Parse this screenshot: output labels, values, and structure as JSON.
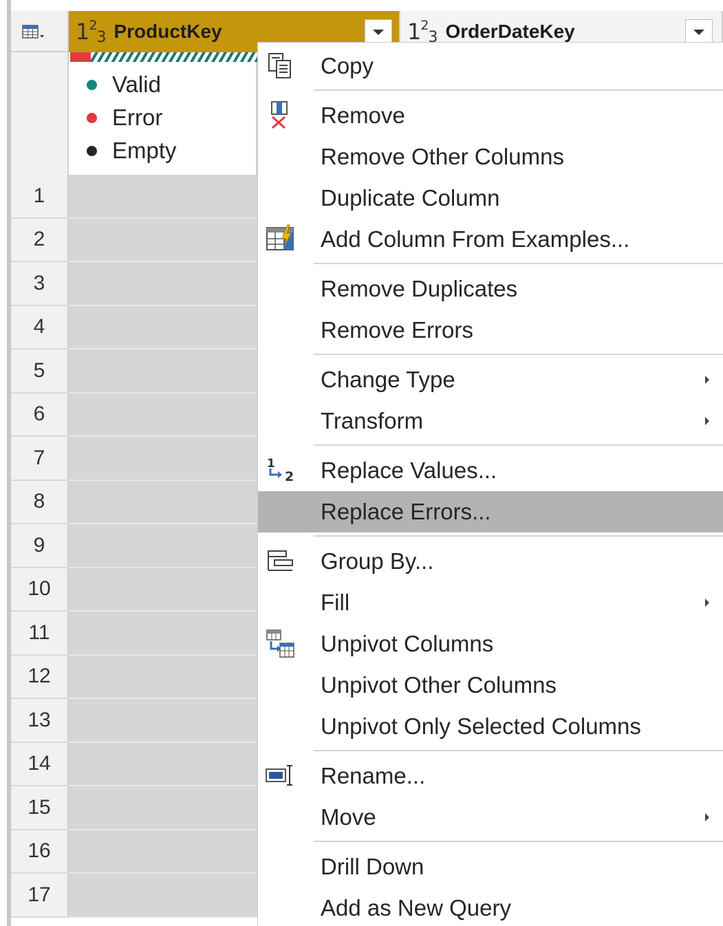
{
  "columns": [
    {
      "type_icon": {
        "base": "1",
        "sup": "2",
        "sub": "3"
      },
      "name": "ProductKey",
      "selected": true
    },
    {
      "type_icon": {
        "base": "1",
        "sup": "2",
        "sub": "3"
      },
      "name": "OrderDateKey",
      "selected": false
    }
  ],
  "quality_legend": [
    {
      "label": "Valid",
      "color": "#17877a"
    },
    {
      "label": "Error",
      "color": "#e6393f"
    },
    {
      "label": "Empty",
      "color": "#262626"
    }
  ],
  "row_numbers": [
    "1",
    "2",
    "3",
    "4",
    "5",
    "6",
    "7",
    "8",
    "9",
    "10",
    "11",
    "12",
    "13",
    "14",
    "15",
    "16",
    "17"
  ],
  "menu": {
    "items": [
      {
        "label": "Copy",
        "icon": "copy-icon"
      },
      {
        "label": "Remove",
        "icon": "remove-column-icon"
      },
      {
        "label": "Remove Other Columns"
      },
      {
        "label": "Duplicate Column"
      },
      {
        "label": "Add Column From Examples...",
        "icon": "column-from-examples-icon"
      },
      {
        "label": "Remove Duplicates"
      },
      {
        "label": "Remove Errors"
      },
      {
        "label": "Change Type",
        "submenu": true
      },
      {
        "label": "Transform",
        "submenu": true
      },
      {
        "label": "Replace Values...",
        "icon": "replace-values-icon"
      },
      {
        "label": "Replace Errors...",
        "highlighted": true
      },
      {
        "label": "Group By...",
        "icon": "group-by-icon"
      },
      {
        "label": "Fill",
        "submenu": true
      },
      {
        "label": "Unpivot Columns",
        "icon": "unpivot-icon"
      },
      {
        "label": "Unpivot Other Columns"
      },
      {
        "label": "Unpivot Only Selected Columns"
      },
      {
        "label": "Rename...",
        "icon": "rename-icon"
      },
      {
        "label": "Move",
        "submenu": true
      },
      {
        "label": "Drill Down"
      },
      {
        "label": "Add as New Query"
      }
    ]
  }
}
